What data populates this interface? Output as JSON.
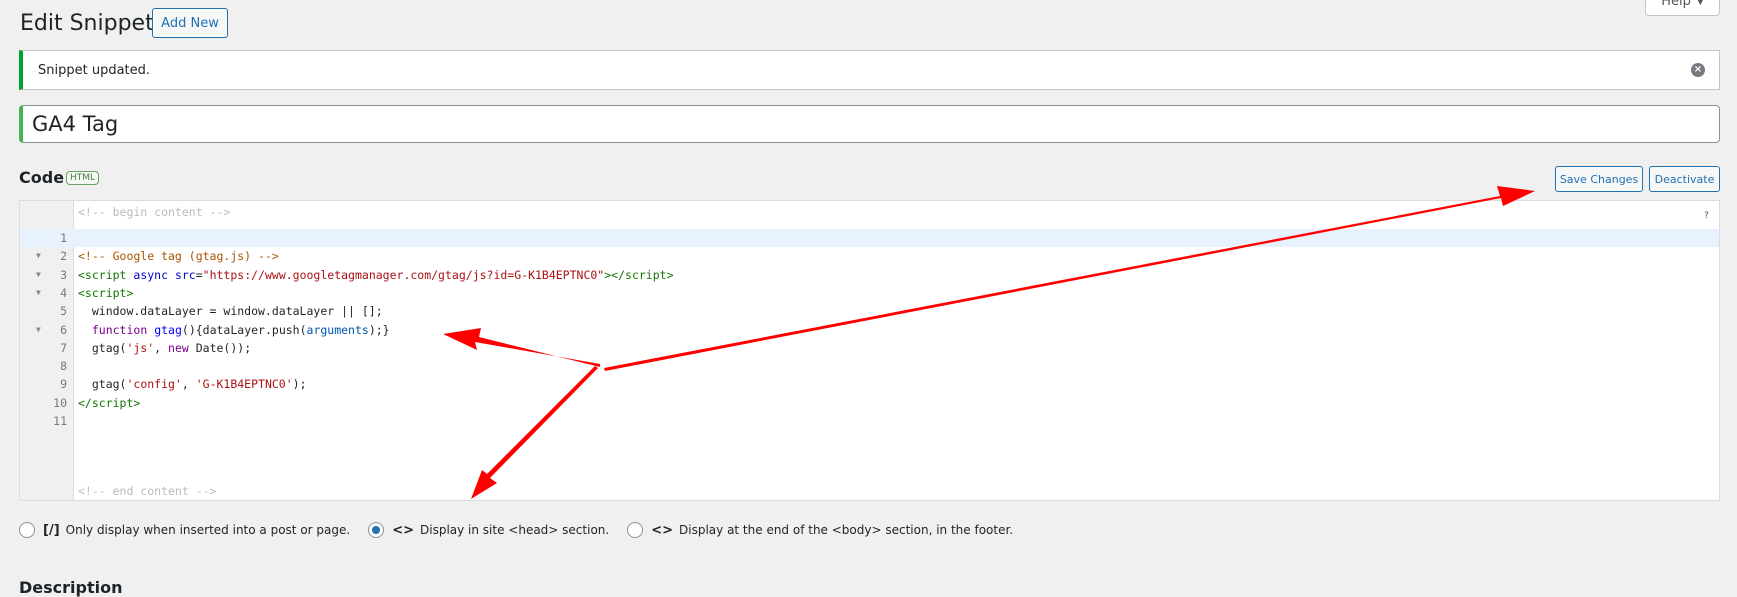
{
  "header": {
    "title": "Edit Snippet",
    "add_new": "Add New",
    "help": "Help",
    "help_icon": "triangle-down"
  },
  "notice": {
    "text": "Snippet updated.",
    "dismiss_icon": "close-circle-icon"
  },
  "snippet": {
    "title": "GA4 Tag"
  },
  "code": {
    "label": "Code",
    "type_badge": "HTML",
    "save": "Save Changes",
    "deactivate": "Deactivate",
    "help_mark": "?",
    "begin_marker": "<!-- begin content -->",
    "end_marker": "<!-- end content -->",
    "lines": [
      "",
      "<!-- Google tag (gtag.js) -->",
      "<script async src=\"https://www.googletagmanager.com/gtag/js?id=G-K1B4EPTNC0\"></script>",
      "<script>",
      "  window.dataLayer = window.dataLayer || [];",
      "  function gtag(){dataLayer.push(arguments);}",
      "  gtag('js', new Date());",
      "",
      "  gtag('config', 'G-K1B4EPTNC0');",
      "</script>",
      ""
    ],
    "line_numbers": [
      "1",
      "2",
      "3",
      "4",
      "5",
      "6",
      "7",
      "8",
      "9",
      "10",
      "11"
    ]
  },
  "scope": {
    "options": [
      {
        "icon": "[/]",
        "label": "Only display when inserted into a post or page.",
        "checked": false
      },
      {
        "icon": "<>",
        "label": "Display in site <head> section.",
        "checked": true
      },
      {
        "icon": "<>",
        "label": "Display at the end of the <body> section, in the footer.",
        "checked": false
      }
    ]
  },
  "description": {
    "label": "Description"
  },
  "annotation_color": "#ff0000"
}
